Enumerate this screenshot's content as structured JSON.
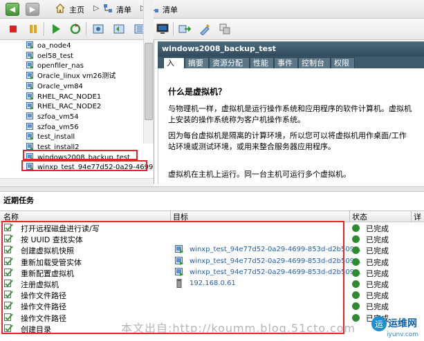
{
  "navbar": {
    "breadcrumb": [
      "主页",
      "清单",
      "清单"
    ]
  },
  "toolbar": {
    "buttons": [
      "stop-icon",
      "pause-icon",
      "play-icon",
      "reset-icon",
      "snapshot-icon",
      "revert-icon",
      "snapshot-manager-icon",
      "console-icon",
      "migrate-icon",
      "edit-settings-icon",
      "clone-icon"
    ]
  },
  "tree": {
    "items": [
      {
        "label": "oa_node4",
        "state": "on"
      },
      {
        "label": "oel58_test",
        "state": "on"
      },
      {
        "label": "openfiler_nas",
        "state": "on"
      },
      {
        "label": "Oracle_linux vm26测试",
        "state": "on"
      },
      {
        "label": "Oracle_vm84",
        "state": "on"
      },
      {
        "label": "RHEL_RAC_NODE1",
        "state": "on"
      },
      {
        "label": "RHEL_RAC_NODE2",
        "state": "on"
      },
      {
        "label": "szfoa_vm54",
        "state": "off"
      },
      {
        "label": "szfoa_vm56",
        "state": "off"
      },
      {
        "label": "test_install",
        "state": "on"
      },
      {
        "label": "test_install2",
        "state": "on"
      },
      {
        "label": "windows2008_backup_test",
        "state": "on",
        "highlighted": true
      },
      {
        "label": "winxp_test_94e77d52-0a29-4699",
        "state": "on",
        "highlighted": true
      }
    ]
  },
  "panel": {
    "title": "windows2008_backup_test",
    "tabs": [
      "入门",
      "摘要",
      "资源分配",
      "性能",
      "事件",
      "控制台",
      "权限"
    ],
    "active_tab": "入门",
    "heading": "什么是虚拟机？",
    "paragraphs": [
      "与物理机一样，虚拟机是运行操作系统和应用程序的软件计算机。虚拟机上安装的操作系统称为客户机操作系统。",
      "因为每台虚拟机是隔离的计算环境，所以您可以将虚拟机用作桌面/工作站环境或测试环境，或用来整合服务器应用程序。",
      "虚拟机在主机上运行。同一台主机可运行多个虚拟机。"
    ]
  },
  "recent_tasks": {
    "title": "近期任务",
    "columns": [
      "名称",
      "目标",
      "状态",
      "详"
    ],
    "rows": [
      {
        "name": "打开远程磁盘进行读/写",
        "target": "",
        "status": "已完成"
      },
      {
        "name": "按 UUID 查找实体",
        "target": "",
        "status": "已完成"
      },
      {
        "name": "创建虚拟机快照",
        "target": "winxp_test_94e77d52-0a29-4699-853d-d2b509...",
        "status": "已完成"
      },
      {
        "name": "重新加载受管实体",
        "target": "winxp_test_94e77d52-0a29-4699-853d-d2b509...",
        "status": "已完成"
      },
      {
        "name": "重新配置虚拟机",
        "target": "winxp_test_94e77d52-0a29-4699-853d-d2b509...",
        "status": "已完成"
      },
      {
        "name": "注册虚拟机",
        "target": "192.168.0.61",
        "status": "已完成"
      },
      {
        "name": "操作文件路径",
        "target": "",
        "status": "已完成"
      },
      {
        "name": "操作文件路径",
        "target": "",
        "status": "已完成"
      },
      {
        "name": "操作文件路径",
        "target": "",
        "status": "已完成"
      },
      {
        "name": "创建目录",
        "target": "",
        "status": ""
      }
    ]
  },
  "watermark": "本文出自:http://koumm.blog.51cto.com",
  "logo_text": "运维网",
  "logo_sub": "iyunv.com",
  "colors": {
    "highlight_red": "#e8232a",
    "title_bar": "#3e5a6b",
    "link_blue": "#1a5fb4",
    "ok_green": "#2e8b2e"
  }
}
